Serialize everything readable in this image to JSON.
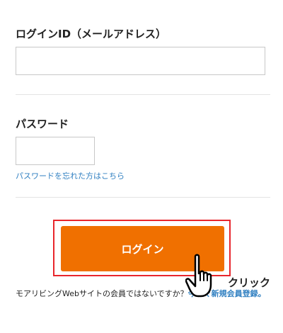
{
  "login_id": {
    "label": "ログインID（メールアドレス）",
    "value": "",
    "placeholder": ""
  },
  "password": {
    "label": "パスワード",
    "value": "",
    "placeholder": "",
    "forgot_link": "パスワードを忘れた方はこちら"
  },
  "login_button": {
    "label": "ログイン"
  },
  "annotation": {
    "click_label": "クリック",
    "highlight_color": "#e8262c"
  },
  "register": {
    "prefix": "モアリビングWebサイトの会員ではないですか？",
    "link": "今すぐ新規会員登録。"
  },
  "colors": {
    "accent": "#f07000",
    "link": "#2f7fc1"
  }
}
